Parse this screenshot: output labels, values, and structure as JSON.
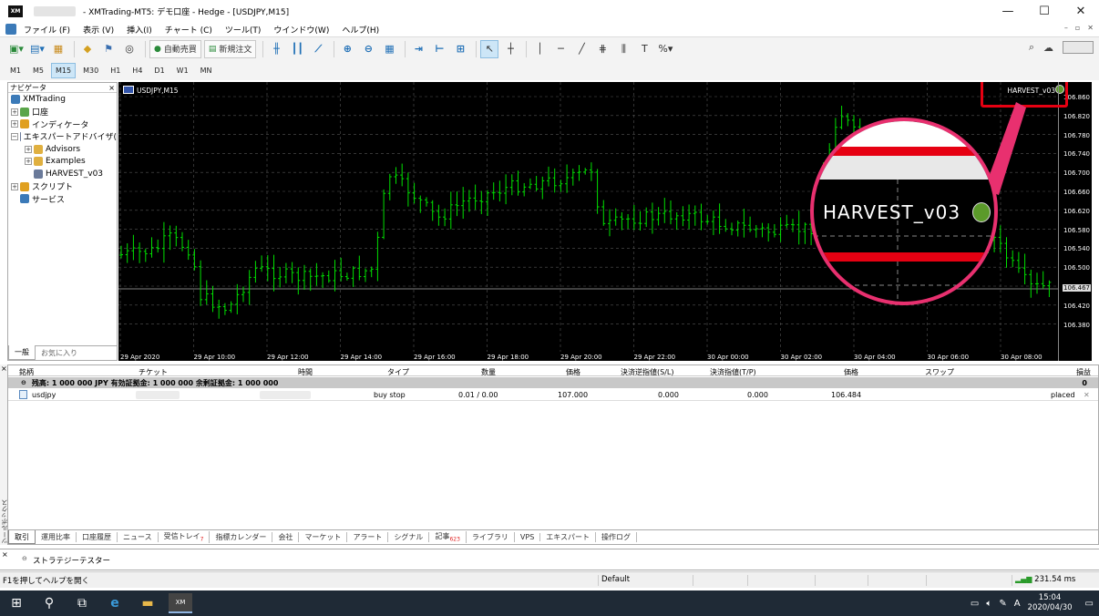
{
  "window": {
    "title": "- XMTrading-MT5: デモ口座 - Hedge - [USDJPY,M15]",
    "min": "—",
    "max": "☐",
    "close": "✕"
  },
  "menu": [
    "ファイル (F)",
    "表示 (V)",
    "挿入(I)",
    "チャート (C)",
    "ツール(T)",
    "ウインドウ(W)",
    "ヘルプ(H)"
  ],
  "toolbar": {
    "auto_trade": "自動売買",
    "new_order": "新規注文"
  },
  "timeframes": [
    "M1",
    "M5",
    "M15",
    "M30",
    "H1",
    "H4",
    "D1",
    "W1",
    "MN"
  ],
  "active_timeframe": "M15",
  "navigator": {
    "title": "ナビゲータ",
    "close": "×",
    "items": [
      "XMTrading",
      "口座",
      "インディケータ",
      "エキスパートアドバイザ(",
      "Advisors",
      "Examples",
      "HARVEST_v03",
      "スクリプト",
      "サービス"
    ],
    "tabs": [
      "一般",
      "お気に入り"
    ]
  },
  "chart": {
    "symbol": "USDJPY,M15",
    "ea_name": "HARVEST_v03",
    "current_price": "106.467",
    "price_ticks": [
      "106.860",
      "106.820",
      "106.780",
      "106.740",
      "106.700",
      "106.660",
      "106.620",
      "106.580",
      "106.540",
      "106.500",
      "106.460",
      "106.420",
      "106.380"
    ],
    "time_ticks": [
      "29 Apr 2020",
      "29 Apr 10:00",
      "29 Apr 12:00",
      "29 Apr 14:00",
      "29 Apr 16:00",
      "29 Apr 18:00",
      "29 Apr 20:00",
      "29 Apr 22:00",
      "30 Apr 00:00",
      "30 Apr 02:00",
      "30 Apr 04:00",
      "30 Apr 06:00",
      "30 Apr 08:00"
    ],
    "colors": {
      "bars": "#00e000",
      "background": "#000000",
      "highlight": "#e60012",
      "zoom_border": "#e8306f"
    }
  },
  "toolbox": {
    "close": "×",
    "side_label": "ツールボックス",
    "headers": [
      "銘柄",
      "チケット",
      "時間",
      "タイプ",
      "数量",
      "価格",
      "決済逆指値(S/L)",
      "決済指値(T/P)",
      "価格",
      "スワップ",
      "損益"
    ],
    "balance_row": {
      "text": "残高: 1 000 000 JPY  有効証拠金: 1 000 000  余剰証拠金: 1 000 000",
      "profit": "0"
    },
    "order": {
      "symbol": "usdjpy",
      "type": "buy stop",
      "volume": "0.01 / 0.00",
      "price": "107.000",
      "sl": "0.000",
      "tp": "0.000",
      "cur_price": "106.484",
      "status": "placed"
    },
    "tabs": [
      {
        "label": "取引"
      },
      {
        "label": "運用比率"
      },
      {
        "label": "口座履歴"
      },
      {
        "label": "ニュース"
      },
      {
        "label": "受信トレイ",
        "badge": "7"
      },
      {
        "label": "指標カレンダー"
      },
      {
        "label": "会社"
      },
      {
        "label": "マーケット"
      },
      {
        "label": "アラート"
      },
      {
        "label": "シグナル"
      },
      {
        "label": "記事",
        "badge": "623"
      },
      {
        "label": "ライブラリ"
      },
      {
        "label": "VPS"
      },
      {
        "label": "エキスパート"
      },
      {
        "label": "操作ログ"
      }
    ]
  },
  "tester": {
    "close": "×",
    "label": "ストラテジーテスター"
  },
  "status": {
    "help": "F1を押してヘルプを開く",
    "profile": "Default",
    "ping": "231.54 ms"
  },
  "taskbar": {
    "time": "15:04",
    "date": "2020/04/30",
    "ime": "A"
  }
}
